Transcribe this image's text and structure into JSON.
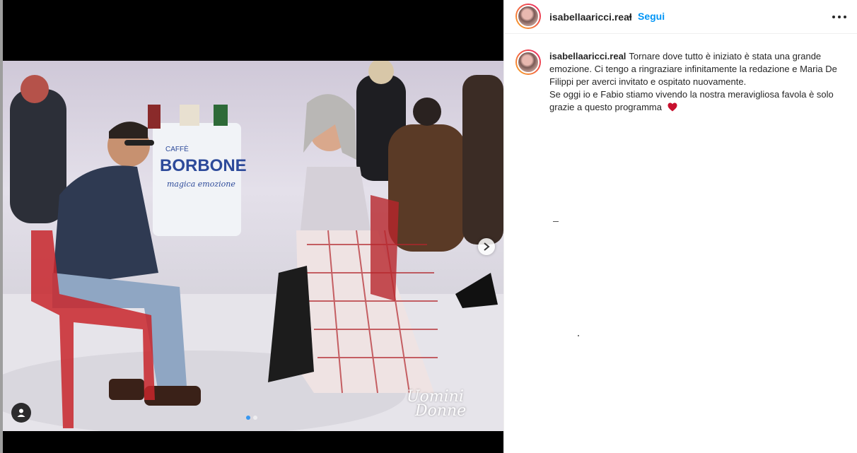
{
  "post": {
    "username": "isabellaaricci.real",
    "separator": "•",
    "follow_label": "Segui",
    "caption_line1": "Tornare dove tutto è iniziato è stata una grande emozione. Ci tengo a ringraziare infinitamente la redazione e Maria De Filippi per averci invitato e ospitato nuovamente.",
    "caption_line2": "Se oggi io e Fabio stiamo vivendo la nostra meravigliosa favola è solo grazie a questo programma",
    "caption_emoji": "heart-emoji"
  },
  "photo": {
    "sign_brand": "BORBONE",
    "sign_top": "CAFFÈ",
    "sign_tagline": "magica emozione",
    "watermark_line1": "Uomini",
    "watermark_line2": "Donne"
  },
  "carousel": {
    "current": 1,
    "total": 2
  },
  "icons": {
    "next": "chevron-right-icon",
    "tag": "user-tag-icon",
    "more": "more-options-icon"
  },
  "colors": {
    "accent": "#0095f6",
    "text": "#262626",
    "heart": "#ed4956"
  }
}
